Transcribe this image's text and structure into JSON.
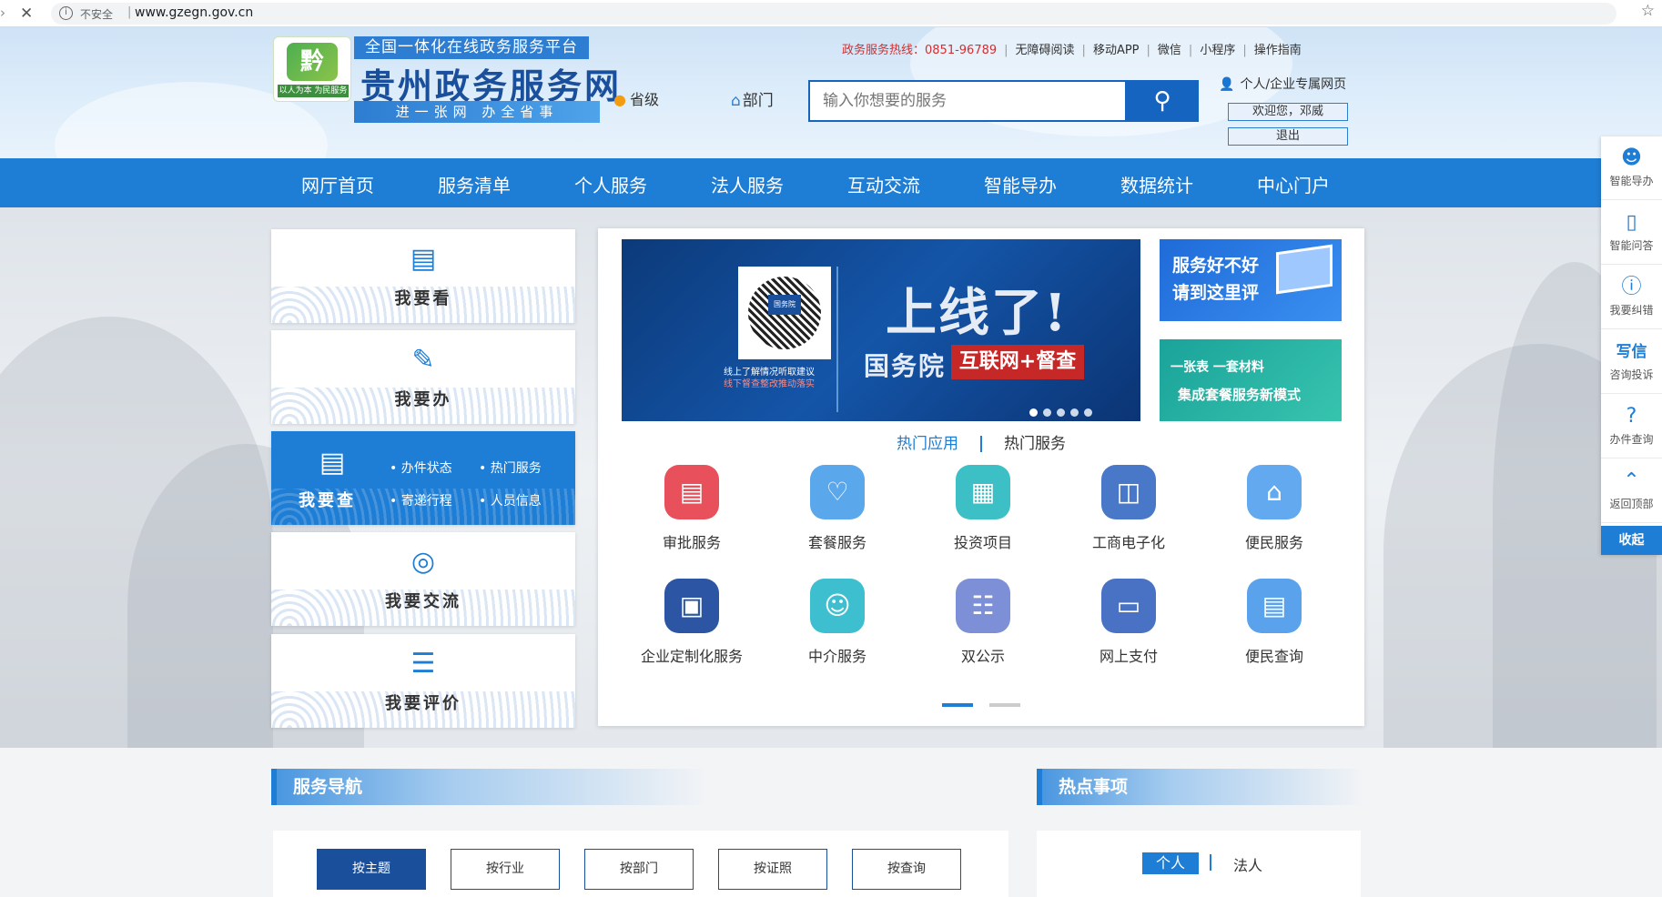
{
  "browser": {
    "security_label": "不安全",
    "url": "www.gzegn.gov.cn"
  },
  "header": {
    "tagline_top": "全国一体化在线政务服务平台",
    "site_title": "贵州政务服务网",
    "tagline_bottom": "进一张网 办全省事",
    "logo_char": "黔",
    "logo_sub": "以人为本 为民服务",
    "level_label": "省级",
    "dept_label": "部门",
    "search_placeholder": "输入你想要的服务",
    "hotline_label": "政务服务热线：0851-96789",
    "links": [
      "无障碍阅读",
      "移动APP",
      "微信",
      "小程序",
      "操作指南"
    ],
    "user_label": "个人/企业专属网页",
    "welcome_label": "欢迎您，邓威",
    "logout_label": "退出"
  },
  "nav": {
    "items": [
      "网厅首页",
      "服务清单",
      "个人服务",
      "法人服务",
      "互动交流",
      "智能导办",
      "数据统计",
      "中心门户"
    ]
  },
  "left_cards": {
    "see": "我要看",
    "do": "我要办",
    "check": "我要查",
    "check_subs": [
      "办件状态",
      "热门服务",
      "寄递行程",
      "人员信息"
    ],
    "talk": "我要交流",
    "rate": "我要评价"
  },
  "banner": {
    "qr_badge": "国务院",
    "qr_text_line1": "线上了解情况听取建议",
    "qr_text_line2": "线下督查整改推动落实",
    "headline": "上线了!",
    "org": "国务院",
    "tag": "互联网+督查"
  },
  "promos": {
    "p1_line1": "服务好不好",
    "p1_line2": "请到这里评",
    "p2_line1": "一张表 一套材料",
    "p2_line2": "集成套餐服务新模式"
  },
  "hot_tabs": {
    "apps": "热门应用",
    "services": "热门服务"
  },
  "apps": [
    {
      "name": "审批服务",
      "color": "#e8505b",
      "icon": "document-icon"
    },
    {
      "name": "套餐服务",
      "color": "#5aa7ec",
      "icon": "heart-icon"
    },
    {
      "name": "投资项目",
      "color": "#3cc0c5",
      "icon": "coins-icon"
    },
    {
      "name": "工商电子化",
      "color": "#4a78c8",
      "icon": "chart-icon"
    },
    {
      "name": "便民服务",
      "color": "#62a9f0",
      "icon": "house-icon"
    },
    {
      "name": "企业定制化服务",
      "color": "#2c55a3",
      "icon": "briefcase-icon"
    },
    {
      "name": "中介服务",
      "color": "#3ebfd0",
      "icon": "person-icon"
    },
    {
      "name": "双公示",
      "color": "#7d8fd6",
      "icon": "board-icon"
    },
    {
      "name": "网上支付",
      "color": "#4a72c4",
      "icon": "wallet-icon"
    },
    {
      "name": "便民查询",
      "color": "#5aa2ec",
      "icon": "search-doc-icon"
    }
  ],
  "float_bar": {
    "items": [
      "智能导办",
      "智能问答",
      "我要纠错",
      "咨询投诉",
      "办件查询",
      "返回顶部"
    ],
    "write_label": "写信",
    "collapse_label": "收起"
  },
  "sections": {
    "nav_title": "服务导航",
    "hot_title": "热点事项",
    "nav_buttons": [
      "按主题",
      "按行业",
      "按部门",
      "按证照",
      "按查询"
    ],
    "hot_tab1": "个人",
    "hot_tab2": "法人"
  }
}
